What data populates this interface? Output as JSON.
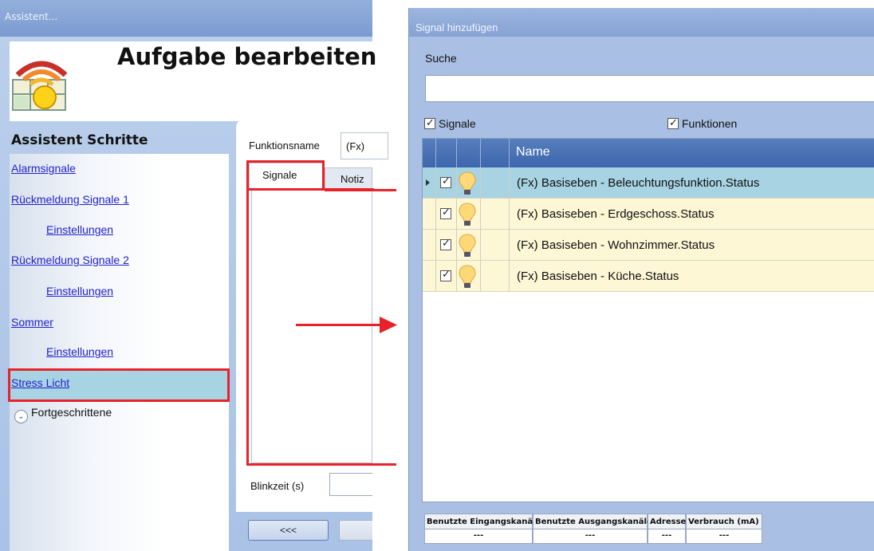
{
  "left_window": {
    "title": "Assistent...",
    "heading": "Aufgabe bearbeiten",
    "steps_title": "Assistent Schritte",
    "steps": [
      {
        "label": "Alarmsignale"
      },
      {
        "label": "Rückmeldung Signale 1"
      },
      {
        "label": "Einstellungen"
      },
      {
        "label": "Rückmeldung Signale 2"
      },
      {
        "label": "Einstellungen"
      },
      {
        "label": "Sommer"
      },
      {
        "label": "Einstellungen"
      },
      {
        "label": "Stress Licht"
      }
    ],
    "advanced_label": "Fortgeschrittene",
    "function_name_label": "Funktionsname",
    "function_name_value": "(Fx)",
    "tabs": {
      "signale": "Signale",
      "notiz": "Notiz"
    },
    "blink_label": "Blinkzeit (s)",
    "back_button": "<<<"
  },
  "right_window": {
    "title": "Signal hinzufügen",
    "search_label": "Suche",
    "search_value": "",
    "filter_signale": "Signale",
    "filter_funktionen": "Funktionen",
    "column_name": "Name",
    "rows": [
      {
        "name": "(Fx) Basiseben - Beleuchtungsfunktion.Status",
        "checked": true,
        "selected": true
      },
      {
        "name": "(Fx) Basiseben - Erdgeschoss.Status",
        "checked": true,
        "selected": false
      },
      {
        "name": "(Fx) Basiseben - Wohnzimmer.Status",
        "checked": true,
        "selected": false
      },
      {
        "name": "(Fx) Basiseben - Küche.Status",
        "checked": true,
        "selected": false
      }
    ],
    "stats": {
      "headers": [
        "Benutzte Eingangskanäle",
        "Benutzte Ausgangskanäle",
        "Adresse",
        "Verbrauch (mA)"
      ],
      "values": [
        "---",
        "---",
        "---",
        "---"
      ]
    }
  },
  "colors": {
    "highlight_red": "#e8222a",
    "selected_row": "#a8d3e3",
    "row_bg": "#fdf7d6",
    "header_blue": "#4a72b4"
  }
}
